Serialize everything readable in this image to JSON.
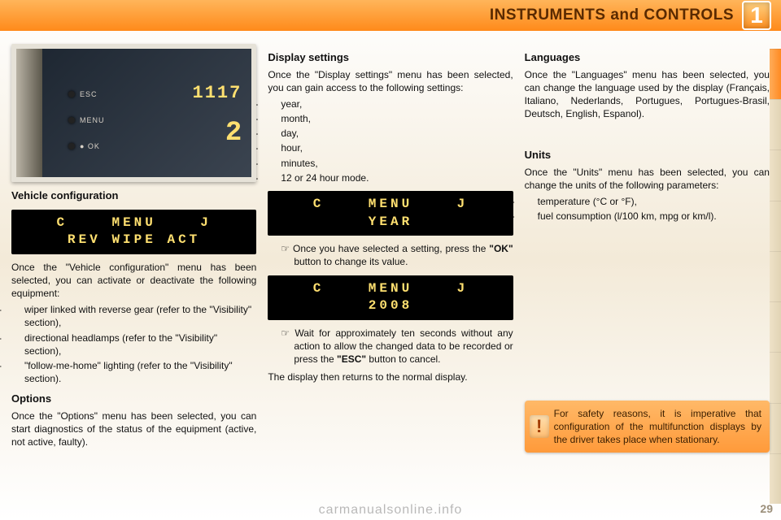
{
  "header": {
    "title": "INSTRUMENTS and CONTROLS",
    "chapter": "1"
  },
  "colA": {
    "photo": {
      "clock": "1117",
      "sub": "2",
      "btn1": "ESC",
      "btn2": "MENU",
      "btn3": "● OK"
    },
    "vehCfgTitle": "Vehicle configuration",
    "lcd1": "C    MENU    J\nREV WIPE ACT",
    "vehCfgIntro": "Once the \"Vehicle configuration\" menu has been selected, you can activate or deactivate the following equipment:",
    "vehCfgItems": [
      "wiper linked with reverse gear (refer to the \"Visibility\" section),",
      "directional headlamps (refer to the \"Visibility\" section),",
      "\"follow-me-home\" lighting (refer to the \"Visibility\" section)."
    ],
    "optionsTitle": "Options",
    "optionsBody": "Once the \"Options\" menu has been selected, you can start diagnostics of the status of the equipment (active, not active, faulty)."
  },
  "colB": {
    "dispTitle": "Display settings",
    "dispIntro": "Once the \"Display settings\" menu has been selected, you can gain access to the following settings:",
    "dispItems": [
      "year,",
      "month,",
      "day,",
      "hour,",
      "minutes,",
      "12 or 24 hour mode."
    ],
    "lcdYear": "C    MENU    J\nYEAR",
    "selectNote_pre": "Once you have selected a setting, press the ",
    "selectNote_ok": "\"OK\"",
    "selectNote_post": " button to change its value.",
    "lcd2008": "C    MENU    J\n2008",
    "waitNote_pre": "Wait for approximately ten seconds without any action to allow the changed data to be recorded or press the ",
    "waitNote_esc": "\"ESC\"",
    "waitNote_post": " button to cancel.",
    "returnNote": "The display then returns to the normal display."
  },
  "colC": {
    "langTitle": "Languages",
    "langBody": "Once the \"Languages\" menu has been selected, you can change the language used by the display (Français, Italiano, Nederlands, Portugues, Portugues-Brasil, Deutsch, English, Espanol).",
    "unitsTitle": "Units",
    "unitsIntro": "Once the \"Units\" menu has been selected, you can change the units of the following parameters:",
    "unitsItems": [
      "temperature (°C or °F),",
      "fuel consumption (l/100 km, mpg or km/l)."
    ],
    "warn": "For safety reasons, it is imperative that configuration of the multifunction displays by the driver takes place when stationary."
  },
  "pagenum": "29",
  "watermark": "carmanualsonline.info"
}
